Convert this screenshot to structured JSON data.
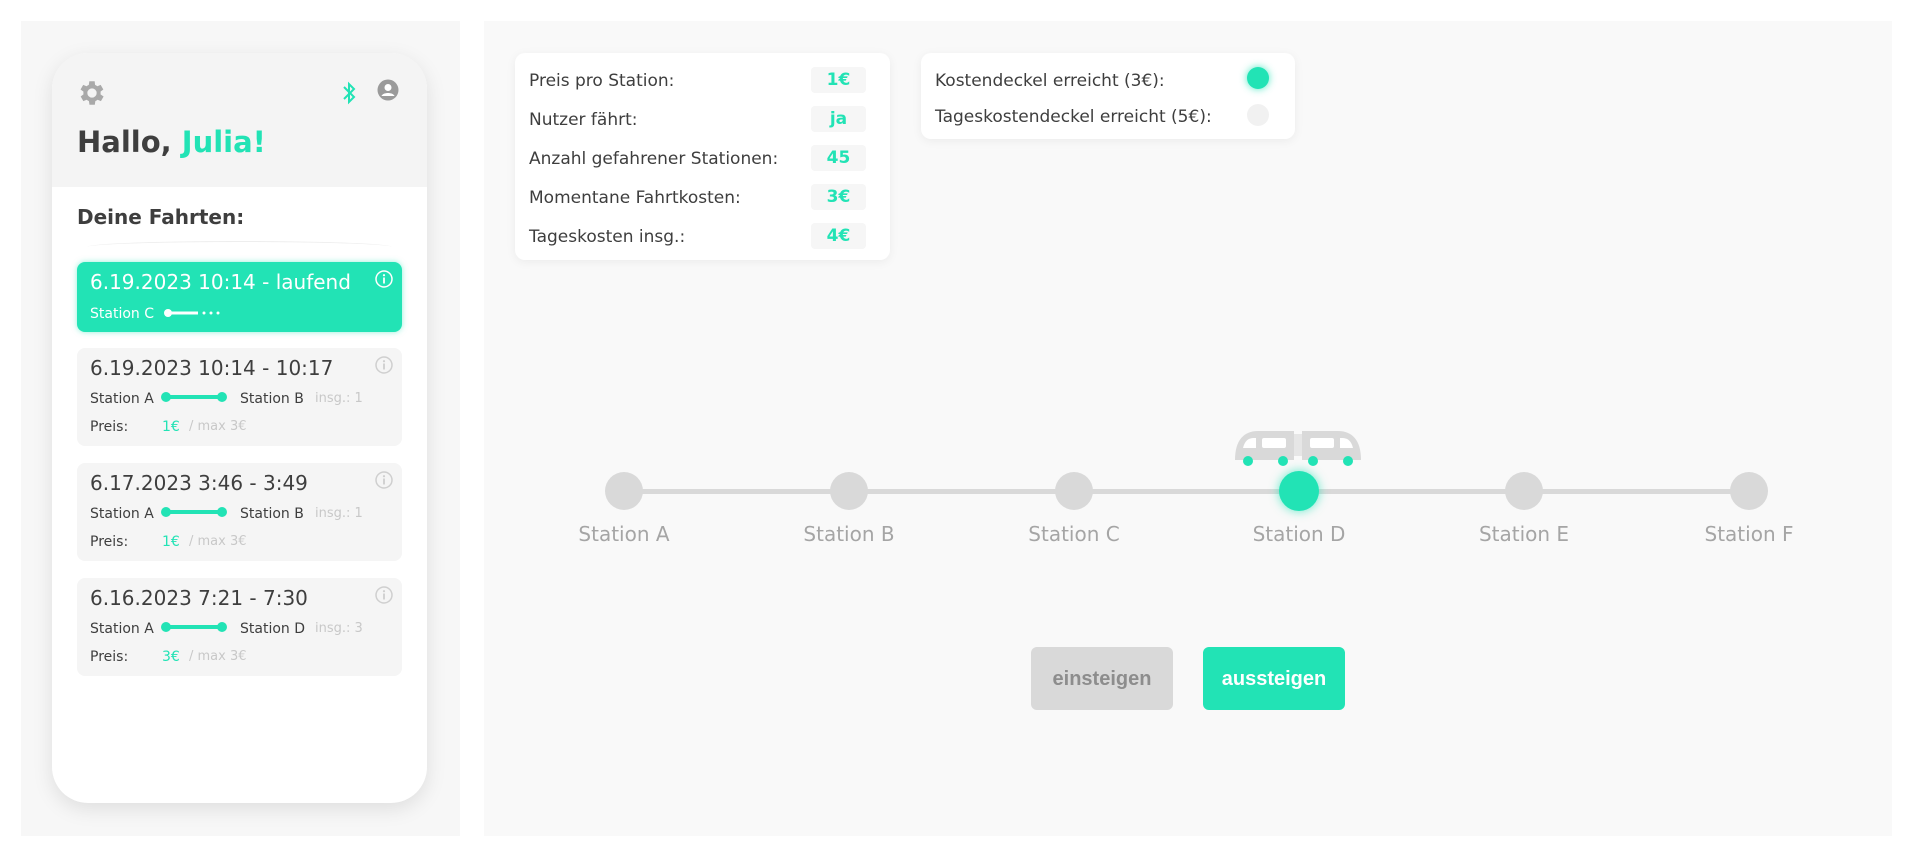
{
  "app": {
    "greeting": "Hallo,",
    "user_name": "Julia!",
    "rides_title": "Deine Fahrten:",
    "accent_color": "#22e3b5",
    "icons": [
      "gear-icon",
      "bluetooth-icon",
      "user-icon",
      "info-icon",
      "train-icon"
    ]
  },
  "rides": [
    {
      "title": "6.19.2023 10:14 - laufend",
      "station": "Station C",
      "active": true
    },
    {
      "title": "6.19.2023 10:14 - 10:17",
      "from": "Station A",
      "to": "Station B",
      "insg": "insg.: 1",
      "preis_label": "Preis:",
      "preis": "1€",
      "max": "/ max 3€"
    },
    {
      "title": "6.17.2023 3:46 - 3:49",
      "from": "Station A",
      "to": "Station B",
      "insg": "insg.: 1",
      "preis_label": "Preis:",
      "preis": "1€",
      "max": "/ max 3€"
    },
    {
      "title": "6.16.2023 7:21 - 7:30",
      "from": "Station A",
      "to": "Station D",
      "insg": "insg.: 3",
      "preis_label": "Preis:",
      "preis": "3€",
      "max": "/ max 3€"
    }
  ],
  "stats": [
    {
      "label": "Preis pro Station:",
      "value": "1€"
    },
    {
      "label": "Nutzer fährt:",
      "value": "ja"
    },
    {
      "label": "Anzahl gefahrener Stationen:",
      "value": "45"
    },
    {
      "label": "Momentane Fahrtkosten:",
      "value": "3€"
    },
    {
      "label": "Tageskosten insg.:",
      "value": "4€"
    }
  ],
  "caps": [
    {
      "label": "Kostendeckel erreicht (3€):",
      "reached": true
    },
    {
      "label": "Tageskostendeckel erreicht (5€):",
      "reached": false
    }
  ],
  "line": {
    "stations": [
      "Station A",
      "Station B",
      "Station C",
      "Station D",
      "Station E",
      "Station F"
    ],
    "current_station": "Station D"
  },
  "buttons": {
    "board": "einsteigen",
    "alight": "aussteigen"
  }
}
